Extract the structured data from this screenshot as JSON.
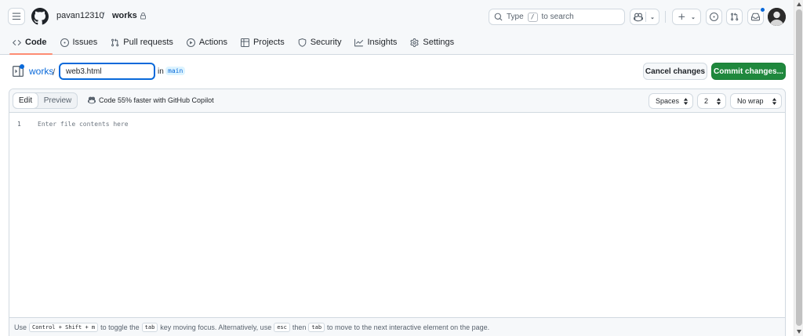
{
  "header": {
    "owner": "pavan12310",
    "separator": "/",
    "repo": "works",
    "search_placeholder_prefix": "Type",
    "search_key": "/",
    "search_placeholder_suffix": "to search"
  },
  "tabs": [
    {
      "label": "Code",
      "icon": "code-icon",
      "active": true
    },
    {
      "label": "Issues",
      "icon": "issue-icon"
    },
    {
      "label": "Pull requests",
      "icon": "pull-request-icon"
    },
    {
      "label": "Actions",
      "icon": "play-icon"
    },
    {
      "label": "Projects",
      "icon": "table-icon"
    },
    {
      "label": "Security",
      "icon": "shield-icon"
    },
    {
      "label": "Insights",
      "icon": "graph-icon"
    },
    {
      "label": "Settings",
      "icon": "gear-icon"
    }
  ],
  "filebar": {
    "repo_link": "works",
    "slash": "/",
    "filename": "web3.html",
    "in_label": "in",
    "branch": "main",
    "cancel_label": "Cancel changes",
    "commit_label": "Commit changes..."
  },
  "editor": {
    "edit_label": "Edit",
    "preview_label": "Preview",
    "copilot_hint": "Code 55% faster with GitHub Copilot",
    "indent_mode": "Spaces",
    "indent_size": "2",
    "wrap_mode": "No wrap",
    "line_number": "1",
    "placeholder": "Enter file contents here"
  },
  "status": {
    "use": "Use",
    "shortcut": "Control + Shift + m",
    "text1": "to toggle the",
    "key_tab": "tab",
    "text2": "key moving focus. Alternatively, use",
    "key_esc": "esc",
    "then": "then",
    "key_tab2": "tab",
    "text3": "to move to the next interactive element on the page."
  },
  "colors": {
    "accent": "#0969da",
    "commit_green": "#1f883d",
    "active_tab_underline": "#fd8c73"
  }
}
